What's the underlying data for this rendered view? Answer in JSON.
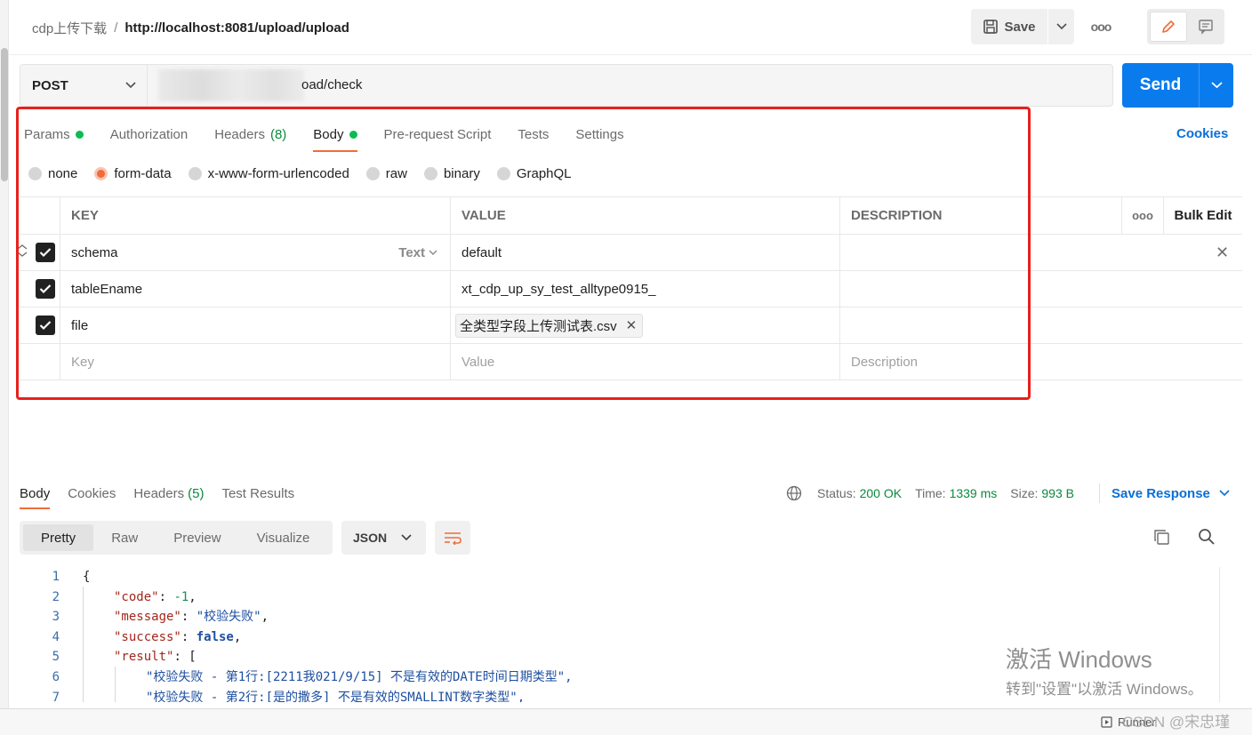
{
  "header": {
    "breadcrumb_parent": "cdp上传下载",
    "breadcrumb_sep": "/",
    "breadcrumb_current": "http://localhost:8081/upload/upload",
    "save_label": "Save"
  },
  "request": {
    "method": "POST",
    "url_visible": "oad/check",
    "send_label": "Send",
    "tabs": [
      {
        "label": "Params",
        "dot": true
      },
      {
        "label": "Authorization"
      },
      {
        "label": "Headers",
        "count": "(8)"
      },
      {
        "label": "Body",
        "dot": true,
        "active": true
      },
      {
        "label": "Pre-request Script"
      },
      {
        "label": "Tests"
      },
      {
        "label": "Settings"
      }
    ],
    "cookies_label": "Cookies",
    "body_types": [
      "none",
      "form-data",
      "x-www-form-urlencoded",
      "raw",
      "binary",
      "GraphQL"
    ],
    "selected_body_type": "form-data"
  },
  "params_table": {
    "headers": {
      "key": "KEY",
      "value": "VALUE",
      "description": "DESCRIPTION",
      "bulk_edit": "Bulk Edit"
    },
    "rows": [
      {
        "key": "schema",
        "type": "Text",
        "value": "default",
        "checked": true
      },
      {
        "key": "tableEname",
        "value": "xt_cdp_up_sy_test_alltype0915_",
        "checked": true
      },
      {
        "key": "file",
        "file": "全类型字段上传测试表.csv",
        "checked": true
      }
    ],
    "placeholders": {
      "key": "Key",
      "value": "Value",
      "description": "Description"
    }
  },
  "response": {
    "tabs": [
      {
        "label": "Body",
        "active": true
      },
      {
        "label": "Cookies"
      },
      {
        "label": "Headers",
        "count": "(5)"
      },
      {
        "label": "Test Results"
      }
    ],
    "status_label": "Status:",
    "status_value": "200 OK",
    "time_label": "Time:",
    "time_value": "1339 ms",
    "size_label": "Size:",
    "size_value": "993 B",
    "save_response_label": "Save Response",
    "view_modes": [
      "Pretty",
      "Raw",
      "Preview",
      "Visualize"
    ],
    "format": "JSON",
    "code_lines": [
      {
        "n": "1",
        "text": "{"
      },
      {
        "n": "2",
        "key": "\"code\"",
        "val": "-1",
        "vtype": "n",
        "tail": ","
      },
      {
        "n": "3",
        "key": "\"message\"",
        "val": "\"校验失败\"",
        "vtype": "s",
        "tail": ","
      },
      {
        "n": "4",
        "key": "\"success\"",
        "val": "false",
        "vtype": "b",
        "tail": ","
      },
      {
        "n": "5",
        "key": "\"result\"",
        "val": "[",
        "vtype": "p",
        "tail": ""
      },
      {
        "n": "6",
        "str": "\"校验失败 - 第1行:[2211我021/9/15] 不是有效的DATE时间日期类型\","
      },
      {
        "n": "7",
        "str": "\"校验失败 - 第2行:[是的撒多] 不是有效的SMALLINT数字类型\","
      }
    ]
  },
  "overlay": {
    "activate_title": "激活 Windows",
    "activate_sub": "转到\"设置\"以激活 Windows。",
    "runner_label": "Runner",
    "watermark": "CSDN @宋忠瑾"
  },
  "colors": {
    "accent": "#f26b3a",
    "send": "#097bed",
    "status_ok": "#0a8a3c",
    "highlight_box": "#e8201d"
  }
}
